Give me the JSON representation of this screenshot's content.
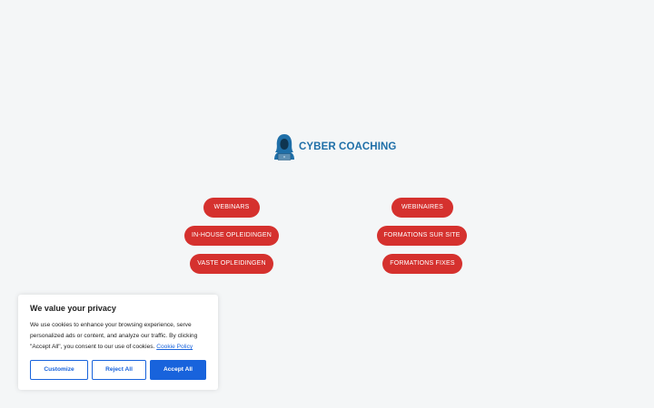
{
  "brand": {
    "name": "CYBER COACHING",
    "color": "#1f6fa8",
    "icon": "hooded-hacker-icon"
  },
  "links": {
    "left": [
      {
        "label": "WEBINARS"
      },
      {
        "label": "IN-HOUSE OPLEIDINGEN"
      },
      {
        "label": "VASTE OPLEIDINGEN"
      }
    ],
    "right": [
      {
        "label": "WEBINAIRES"
      },
      {
        "label": "FORMATIONS SUR SITE"
      },
      {
        "label": "FORMATIONS FIXES"
      }
    ],
    "color": "#d5312e"
  },
  "cookie_banner": {
    "title": "We value your privacy",
    "text": "We use cookies to enhance your browsing experience, serve personalized ads or content, and analyze our traffic. By clicking \"Accept All\", you consent to our use of cookies.",
    "policy_link": "Cookie Policy",
    "customize_label": "Customize",
    "reject_label": "Reject All",
    "accept_label": "Accept All",
    "accent_color": "#1863dc"
  }
}
